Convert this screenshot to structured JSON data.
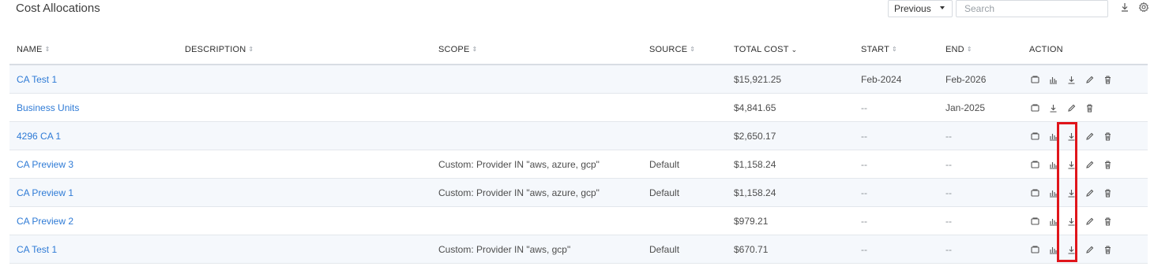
{
  "page": {
    "title": "Cost Allocations"
  },
  "toolbar": {
    "period_selected": "Previous",
    "search_placeholder": "Search"
  },
  "columns": {
    "name": "NAME",
    "description": "DESCRIPTION",
    "scope": "SCOPE",
    "source": "SOURCE",
    "total_cost": "TOTAL COST",
    "start": "START",
    "end": "END",
    "action": "ACTION"
  },
  "rows": [
    {
      "name": "CA Test 1",
      "description": "",
      "scope": "",
      "source": "",
      "total_cost": "$15,921.25",
      "start": "Feb-2024",
      "end": "Feb-2026",
      "has_chart": true
    },
    {
      "name": "Business Units",
      "description": "",
      "scope": "",
      "source": "",
      "total_cost": "$4,841.65",
      "start": "--",
      "end": "Jan-2025",
      "has_chart": false
    },
    {
      "name": "4296 CA 1",
      "description": "",
      "scope": "",
      "source": "",
      "total_cost": "$2,650.17",
      "start": "--",
      "end": "--",
      "has_chart": true
    },
    {
      "name": "CA Preview 3",
      "description": "",
      "scope": "Custom: Provider IN \"aws, azure, gcp\"",
      "source": "Default",
      "total_cost": "$1,158.24",
      "start": "--",
      "end": "--",
      "has_chart": true
    },
    {
      "name": "CA Preview 1",
      "description": "",
      "scope": "Custom: Provider IN \"aws, azure, gcp\"",
      "source": "Default",
      "total_cost": "$1,158.24",
      "start": "--",
      "end": "--",
      "has_chart": true
    },
    {
      "name": "CA Preview 2",
      "description": "",
      "scope": "",
      "source": "",
      "total_cost": "$979.21",
      "start": "--",
      "end": "--",
      "has_chart": true
    },
    {
      "name": "CA Test 1",
      "description": "",
      "scope": "Custom: Provider IN \"aws, gcp\"",
      "source": "Default",
      "total_cost": "$670.71",
      "start": "--",
      "end": "--",
      "has_chart": true
    }
  ],
  "icons": {
    "toolbar": [
      "download-icon",
      "settings-icon"
    ],
    "row_actions": [
      "copy-icon",
      "chart-icon",
      "download-icon",
      "edit-icon",
      "delete-icon"
    ]
  },
  "colors": {
    "link": "#2f7bd6",
    "row_alt": "#f5f8fc",
    "highlight": "#e0151b"
  }
}
